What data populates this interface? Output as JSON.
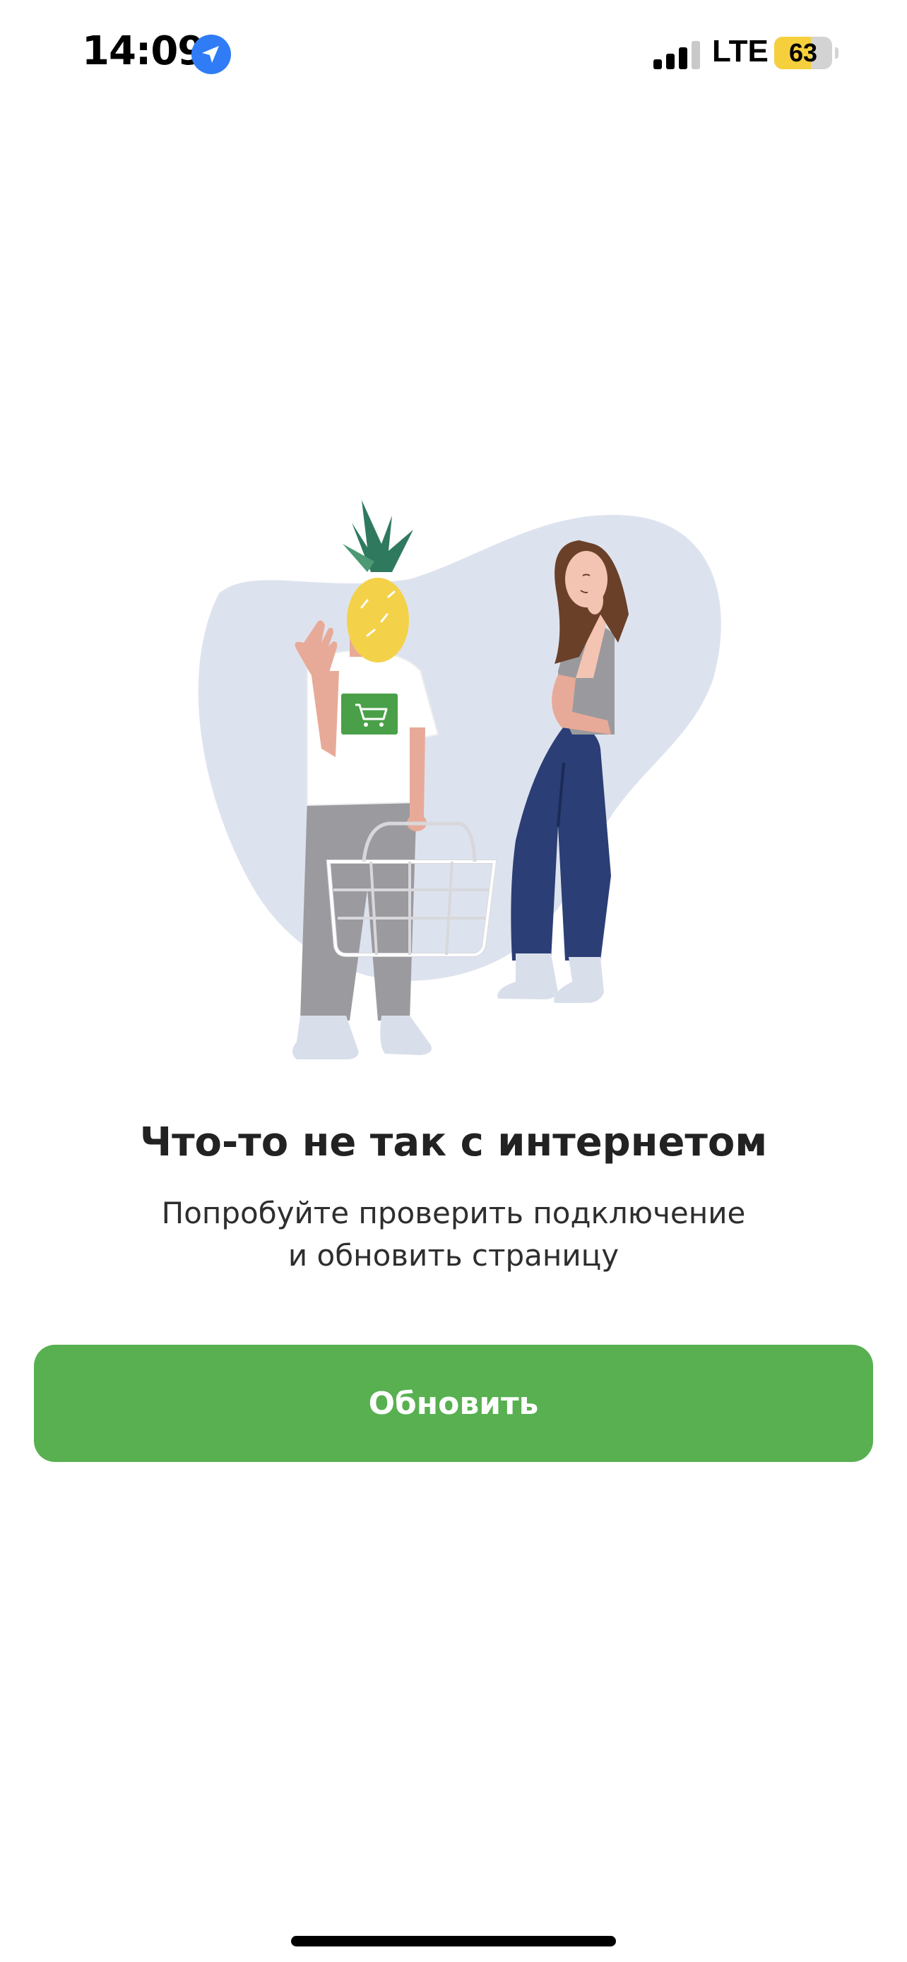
{
  "status_bar": {
    "time": "14:09",
    "network": "LTE",
    "battery_level": "63",
    "battery_color": "#f6cf3c",
    "location_icon": "location-arrow-icon",
    "signal_icon": "cellular-signal-icon"
  },
  "illustration": {
    "name": "no-connection-illustration",
    "blob_color": "#dde3ee",
    "cart_badge_color": "#4aa049"
  },
  "error": {
    "title": "Что-то не так с интернетом",
    "message_line1": "Попробуйте проверить подключение",
    "message_line2": "и обновить страницу"
  },
  "refresh_button": {
    "label": "Обновить",
    "color": "#58b050"
  }
}
